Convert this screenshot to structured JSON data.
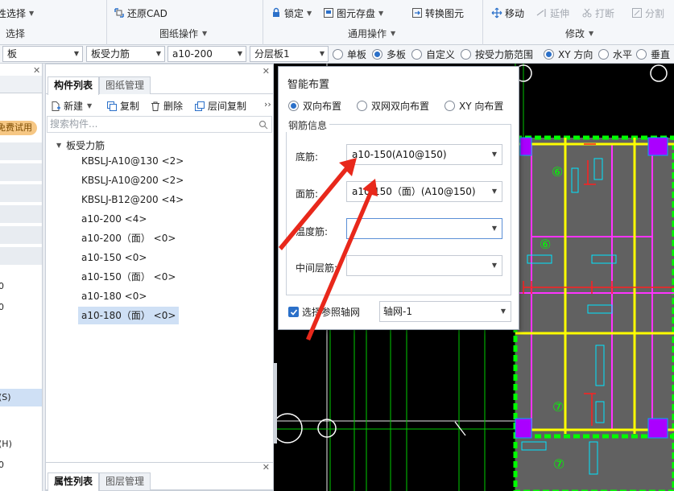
{
  "ribbon": {
    "select_group": {
      "button_label": "性选择",
      "group_label": "选择"
    },
    "drawing_group": {
      "restore_cad": "还原CAD",
      "group_label": "图纸操作"
    },
    "common_group": {
      "lock": "锁定",
      "save_element": "图元存盘",
      "convert_element": "转换图元",
      "group_label": "通用操作"
    },
    "modify_group": {
      "move": "移动",
      "extend": "延伸",
      "break": "打断",
      "split": "分割",
      "group_label": "修改"
    }
  },
  "toolbar2": {
    "combo1": "板",
    "combo2": "板受力筋",
    "combo3": "a10-200",
    "combo4": "分层板1",
    "radios": [
      {
        "label": "单板",
        "checked": false
      },
      {
        "label": "多板",
        "checked": true
      },
      {
        "label": "自定义",
        "checked": false
      },
      {
        "label": "按受力筋范围",
        "checked": false
      },
      {
        "label": "XY 方向",
        "checked": true
      },
      {
        "label": "水平",
        "checked": false
      },
      {
        "label": "垂直",
        "checked": false
      }
    ]
  },
  "left_sliver": {
    "free_trial": "免费试用",
    "item_s": "(S)",
    "item_h": "(H)",
    "item_0a": "0",
    "item_0b": "0",
    "item_0c": "0"
  },
  "component_panel": {
    "tab_component_list": "构件列表",
    "tab_drawing_manage": "图纸管理",
    "new": "新建",
    "copy": "复制",
    "delete": "删除",
    "floor_copy": "层间复制",
    "search_placeholder": "搜索构件...",
    "tree_root": "板受力筋",
    "items": [
      "KBSLJ-A10@130 <2>",
      "KBSLJ-A10@200 <2>",
      "KBSLJ-B12@200 <4>",
      "a10-200 <4>",
      "a10-200（面） <0>",
      "a10-150 <0>",
      "a10-150（面） <0>",
      "a10-180 <0>",
      "a10-180（面） <0>"
    ],
    "selected_index": 8
  },
  "property_panel": {
    "tab_properties": "属性列表",
    "tab_layer_manage": "图层管理"
  },
  "dialog": {
    "title": "智能布置",
    "layout_options": [
      {
        "label": "双向布置",
        "checked": true
      },
      {
        "label": "双网双向布置",
        "checked": false
      },
      {
        "label": "XY 向布置",
        "checked": false
      }
    ],
    "group_title": "钢筋信息",
    "bottom_rebar_label": "底筋:",
    "bottom_rebar_value": "a10-150(A10@150)",
    "top_rebar_label": "面筋:",
    "top_rebar_value": "a10-150（面）(A10@150)",
    "temp_rebar_label": "温度筋:",
    "temp_rebar_value": "",
    "mid_rebar_label": "中间层筋:",
    "mid_rebar_value": "",
    "ref_axis_label": "选择参照轴网",
    "ref_axis_checked": true,
    "ref_axis_value": "轴网-1"
  },
  "cad": {
    "labels": [
      "⑥",
      "⑥",
      "⑦",
      "⑦"
    ],
    "colors": {
      "background": "#000000",
      "slab": "#616161",
      "rebar_yellow": "#ffff00",
      "rebar_magenta": "#ff33ff",
      "grid_green": "#00ff00",
      "dim_red": "#ff2020",
      "column": "#aa00ff"
    }
  },
  "colors": {
    "arrow_red": "#e8281b",
    "accent_blue": "#2b70c9",
    "selected_bg": "#cfe0f5",
    "badge_orange": "#f6c784"
  }
}
